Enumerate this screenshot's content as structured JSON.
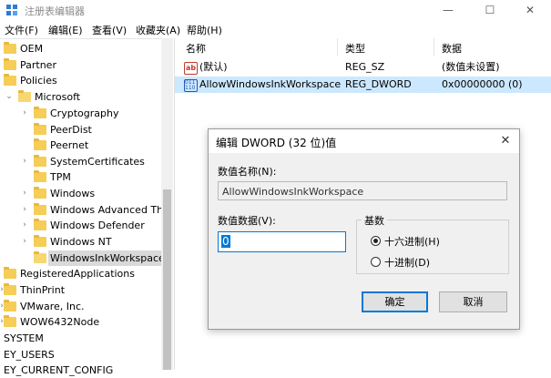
{
  "window": {
    "title": "注册表编辑器",
    "minimize_glyph": "—",
    "maximize_glyph": "☐",
    "close_glyph": "✕"
  },
  "menu": [
    "文件(F)",
    "编辑(E)",
    "查看(V)",
    "收藏夹(A)",
    "帮助(H)"
  ],
  "tree": {
    "items": [
      {
        "label": "OEM"
      },
      {
        "label": "Partner"
      },
      {
        "label": "Policies"
      },
      {
        "label": "Microsoft",
        "expander": "⌄"
      },
      {
        "label": "Cryptography",
        "expander": "›"
      },
      {
        "label": "PeerDist"
      },
      {
        "label": "Peernet"
      },
      {
        "label": "SystemCertificates",
        "expander": "›"
      },
      {
        "label": "TPM"
      },
      {
        "label": "Windows",
        "expander": "›"
      },
      {
        "label": "Windows Advanced Thr",
        "expander": "›"
      },
      {
        "label": "Windows Defender",
        "expander": "›"
      },
      {
        "label": "Windows NT",
        "expander": "›"
      },
      {
        "label": "WindowsInkWorkspace",
        "selected": true
      },
      {
        "label": "RegisteredApplications"
      },
      {
        "label": "ThinPrint",
        "expander": "›"
      },
      {
        "label": "VMware, Inc.",
        "expander": "›"
      },
      {
        "label": "WOW6432Node",
        "expander": "›"
      },
      {
        "label": "SYSTEM"
      },
      {
        "label": "EY_USERS"
      },
      {
        "label": "EY_CURRENT_CONFIG"
      }
    ]
  },
  "values_pane": {
    "columns": [
      "名称",
      "类型",
      "数据"
    ],
    "rows": [
      {
        "icon": "string-value-icon",
        "icon_text": "ab",
        "name": "(默认)",
        "type": "REG_SZ",
        "data": "(数值未设置)"
      },
      {
        "icon": "binary-value-icon",
        "icon_text": "011 110",
        "name": "AllowWindowsInkWorkspace",
        "type": "REG_DWORD",
        "data": "0x00000000 (0)",
        "selected": true
      }
    ]
  },
  "dialog": {
    "title": "编辑 DWORD (32 位)值",
    "close_glyph": "✕",
    "name_label": "数值名称(N):",
    "name_value": "AllowWindowsInkWorkspace",
    "data_label": "数值数据(V):",
    "data_value": "0",
    "base_label": "基数",
    "hex_label": "十六进制(H)",
    "dec_label": "十进制(D)",
    "selected_base": "hex",
    "ok_label": "确定",
    "cancel_label": "取消"
  },
  "colors": {
    "selection_blue": "#cce8ff",
    "accent": "#0078d7",
    "folder": "#f5cd57"
  }
}
